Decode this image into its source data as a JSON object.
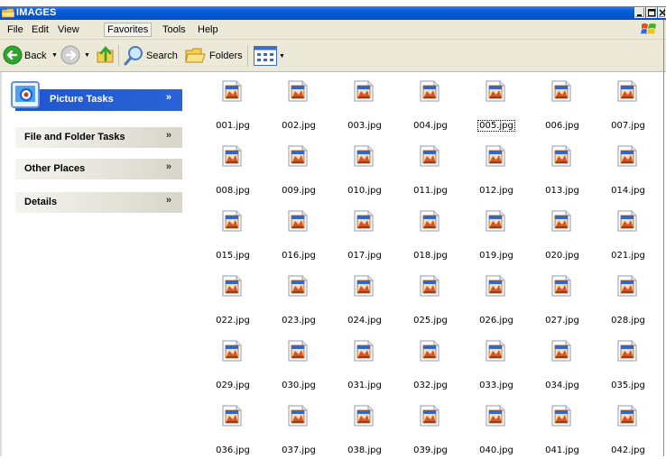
{
  "window": {
    "title": "IMAGES",
    "controls": [
      "minimize",
      "maximize",
      "close"
    ]
  },
  "menubar": {
    "items": [
      "File",
      "Edit",
      "View",
      "Favorites",
      "Tools",
      "Help"
    ],
    "selected": "Favorites"
  },
  "toolbar": {
    "back_label": "Back",
    "search_label": "Search",
    "folders_label": "Folders"
  },
  "left_pane": {
    "panels": [
      {
        "label": "Picture Tasks",
        "icon": "picture-tasks-icon",
        "highlighted": true
      },
      {
        "label": "File and Folder Tasks"
      },
      {
        "label": "Other Places"
      },
      {
        "label": "Details"
      }
    ]
  },
  "files": {
    "selected": "005.jpg",
    "items": [
      "001.jpg",
      "002.jpg",
      "003.jpg",
      "004.jpg",
      "005.jpg",
      "006.jpg",
      "007.jpg",
      "008.jpg",
      "009.jpg",
      "010.jpg",
      "011.jpg",
      "012.jpg",
      "013.jpg",
      "014.jpg",
      "015.jpg",
      "016.jpg",
      "017.jpg",
      "018.jpg",
      "019.jpg",
      "020.jpg",
      "021.jpg",
      "022.jpg",
      "023.jpg",
      "024.jpg",
      "025.jpg",
      "026.jpg",
      "027.jpg",
      "028.jpg",
      "029.jpg",
      "030.jpg",
      "031.jpg",
      "032.jpg",
      "033.jpg",
      "034.jpg",
      "035.jpg",
      "036.jpg",
      "037.jpg",
      "038.jpg",
      "039.jpg",
      "040.jpg",
      "041.jpg",
      "042.jpg"
    ]
  },
  "colors": {
    "titlebar": "#0453d0",
    "chrome": "#ece9d8",
    "task_panel_blue": "#1e55d0"
  }
}
